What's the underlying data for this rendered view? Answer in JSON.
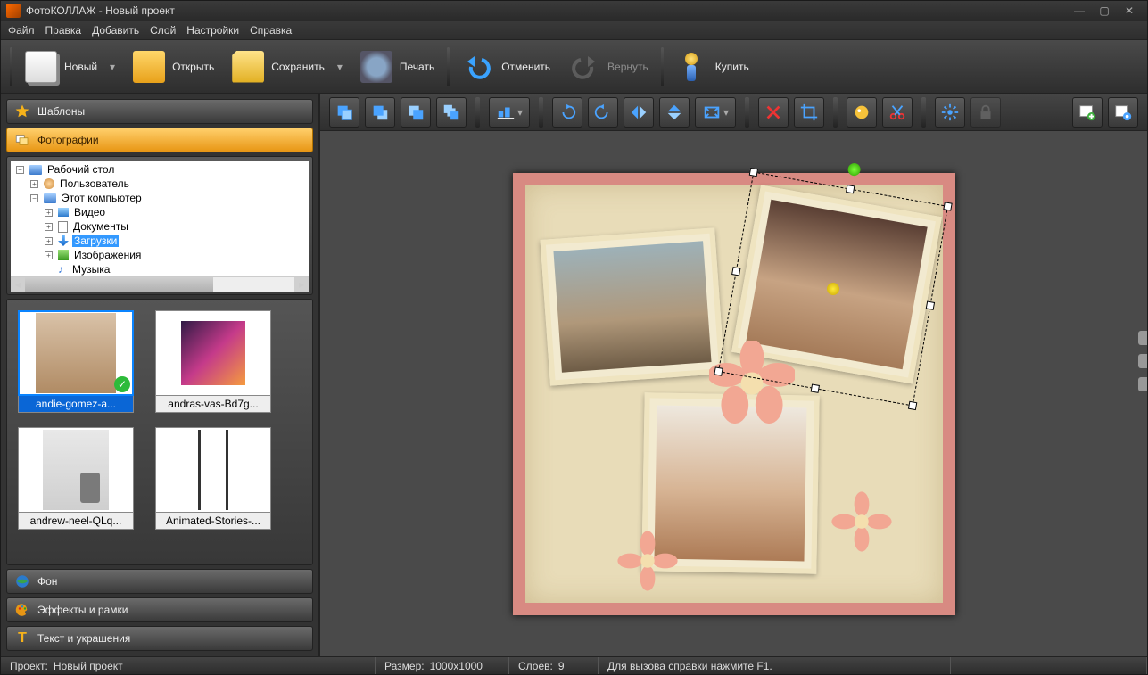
{
  "titlebar": {
    "title": "ФотоКОЛЛАЖ - Новый проект"
  },
  "menu": [
    "Файл",
    "Правка",
    "Добавить",
    "Слой",
    "Настройки",
    "Справка"
  ],
  "toolbar": {
    "new": "Новый",
    "open": "Открыть",
    "save": "Сохранить",
    "print": "Печать",
    "undo": "Отменить",
    "redo": "Вернуть",
    "buy": "Купить"
  },
  "sidebar": {
    "templates": "Шаблоны",
    "photos": "Фотографии",
    "background": "Фон",
    "effects": "Эффекты и рамки",
    "text": "Текст и украшения"
  },
  "tree": {
    "root": "Рабочий стол",
    "user": "Пользователь",
    "computer": "Этот компьютер",
    "video": "Видео",
    "documents": "Документы",
    "downloads": "Загрузки",
    "images": "Изображения",
    "music": "Музыка"
  },
  "thumbs": [
    {
      "caption": "andie-gomez-a..."
    },
    {
      "caption": "andras-vas-Bd7g..."
    },
    {
      "caption": "andrew-neel-QLq..."
    },
    {
      "caption": "Animated-Stories-..."
    }
  ],
  "status": {
    "project_label": "Проект:",
    "project_value": "Новый проект",
    "size_label": "Размер:",
    "size_value": "1000x1000",
    "layers_label": "Слоев:",
    "layers_value": "9",
    "help": "Для вызова справки нажмите F1."
  }
}
